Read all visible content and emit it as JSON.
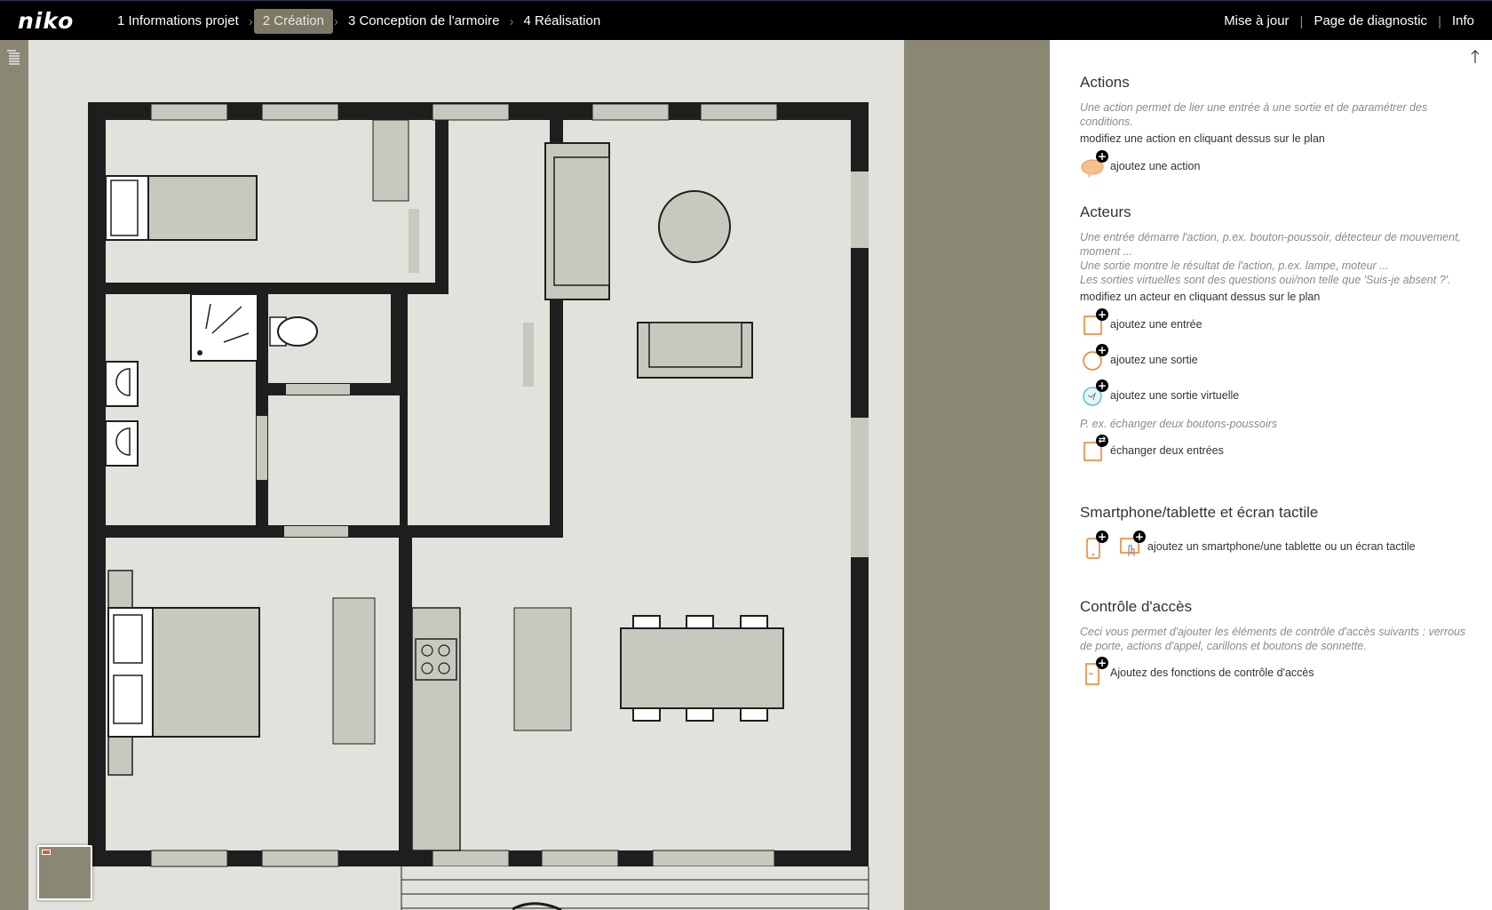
{
  "app": {
    "logo": "niko"
  },
  "steps": [
    {
      "label": "1 Informations projet",
      "active": false
    },
    {
      "label": "2 Création",
      "active": true
    },
    {
      "label": "3 Conception de l'armoire",
      "active": false
    },
    {
      "label": "4 Réalisation",
      "active": false
    }
  ],
  "topnav": {
    "update": "Mise à jour",
    "diagnostic": "Page de diagnostic",
    "info": "Info"
  },
  "panel": {
    "actions": {
      "title": "Actions",
      "desc": "Une action permet de lier une entrée à une sortie et de paramétrer des conditions.",
      "note": "modifiez une action en cliquant dessus sur le plan",
      "add": "ajoutez une action"
    },
    "actors": {
      "title": "Acteurs",
      "desc1": "Une entrée démarre l'action, p.ex. bouton-poussoir, détecteur de mouvement, moment ...",
      "desc2": "Une sortie montre le résultat de l'action, p.ex. lampe, moteur ...",
      "desc3": "Les sorties virtuelles sont des questions oui/non telle que 'Suis-je absent ?'.",
      "note": "modifiez un acteur en cliquant dessus sur le plan",
      "add_input": "ajoutez une entrée",
      "add_output": "ajoutez une sortie",
      "add_virtual": "ajoutez une sortie virtuelle",
      "swap_desc": "P. ex. échanger deux boutons-poussoirs",
      "swap": "échanger deux entrées"
    },
    "smartphone": {
      "title": "Smartphone/tablette et écran tactile",
      "add": "ajoutez un smartphone/une tablette ou un écran tactile"
    },
    "access": {
      "title": "Contrôle d'accès",
      "desc": "Ceci vous permet d'ajouter les éléments de contrôle d'accès suivants : verrous de porte, actions d'appel, carillons et boutons de sonnette.",
      "add": "Ajoutez des fonctions de contrôle d'accès"
    }
  },
  "colors": {
    "accent": "#f07e26",
    "plan_wall": "#1e1e1e",
    "plan_floor": "#e2e2dc",
    "furniture": "#c8c8bf",
    "active_step": "#7d7866"
  },
  "icons": [
    "menu-icon",
    "collapse-up-icon",
    "action-bubble-icon",
    "input-icon",
    "output-icon",
    "virtual-output-icon",
    "swap-icon",
    "smartphone-icon",
    "touchscreen-icon",
    "access-control-icon"
  ]
}
